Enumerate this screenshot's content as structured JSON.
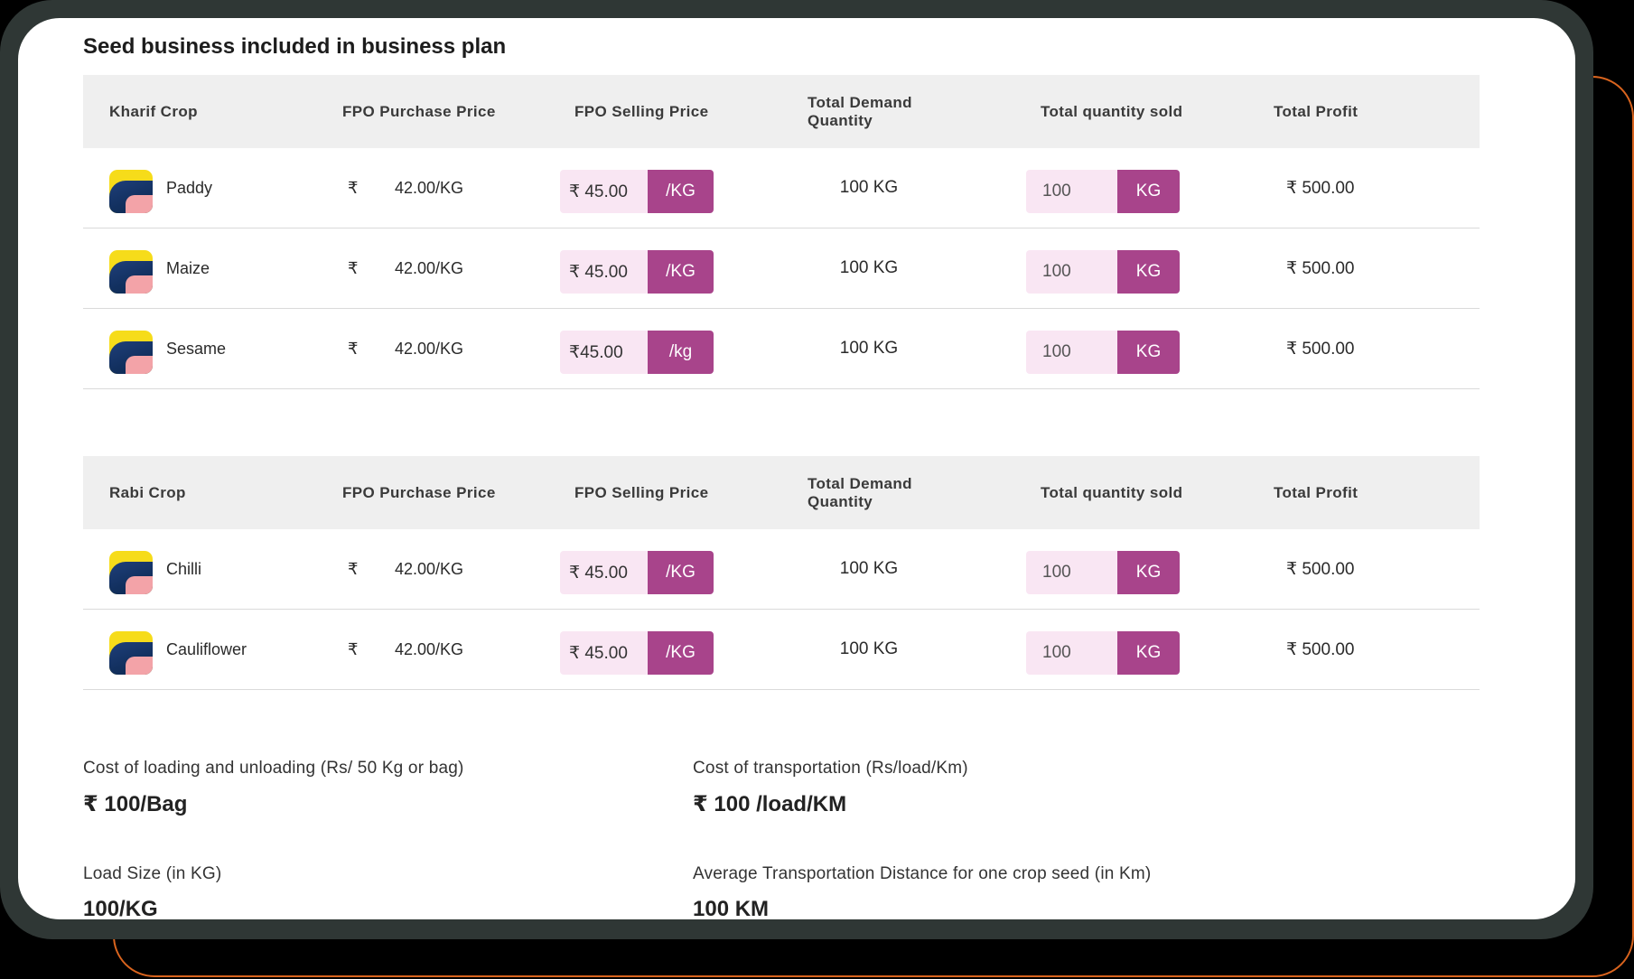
{
  "title": "Seed business included in business plan",
  "headers_common": {
    "purchase": "FPO Purchase Price",
    "selling": "FPO Selling Price",
    "demand": "Total Demand Quantity",
    "sold": "Total quantity sold",
    "profit": "Total Profit"
  },
  "kharif": {
    "header": "Kharif Crop",
    "rows": [
      {
        "name": "Paddy",
        "rupee": "₹",
        "purchase": "42.00/KG",
        "selling": "₹ 45.00",
        "selling_unit": "/KG",
        "demand": "100 KG",
        "sold": "100",
        "sold_unit": "KG",
        "profit": "₹  500.00"
      },
      {
        "name": "Maize",
        "rupee": "₹",
        "purchase": "42.00/KG",
        "selling": "₹ 45.00",
        "selling_unit": "/KG",
        "demand": "100 KG",
        "sold": "100",
        "sold_unit": "KG",
        "profit": "₹  500.00"
      },
      {
        "name": "Sesame",
        "rupee": "₹",
        "purchase": "42.00/KG",
        "selling": "₹45.00",
        "selling_unit": "/kg",
        "demand": "100 KG",
        "sold": "100",
        "sold_unit": "KG",
        "profit": "₹  500.00"
      }
    ]
  },
  "rabi": {
    "header": "Rabi Crop",
    "rows": [
      {
        "name": "Chilli",
        "rupee": "₹",
        "purchase": "42.00/KG",
        "selling": "₹ 45.00",
        "selling_unit": "/KG",
        "demand": "100 KG",
        "sold": "100",
        "sold_unit": "KG",
        "profit": "₹  500.00"
      },
      {
        "name": "Cauliflower",
        "rupee": "₹",
        "purchase": "42.00/KG",
        "selling": "₹ 45.00",
        "selling_unit": "/KG",
        "demand": "100 KG",
        "sold": "100",
        "sold_unit": "KG",
        "profit": "₹  500.00"
      }
    ]
  },
  "info": {
    "loading_label": "Cost of loading and unloading (Rs/ 50 Kg or bag)",
    "loading_value": "₹ 100/Bag",
    "transport_label": "Cost of transportation (Rs/load/Km)",
    "transport_value": "₹ 100 /load/KM",
    "load_size_label": "Load Size (in KG)",
    "load_size_value": "100/KG",
    "distance_label": "Average Transportation Distance for one crop seed (in Km)",
    "distance_value": "100 KM"
  },
  "colors": {
    "accent": "#a8448b",
    "accent_light": "#f9e6f3",
    "header_bg": "#efefef",
    "frame": "#2f3735",
    "outline": "#d9641e"
  },
  "icons": {
    "crop": "crop-thumbnail-icon"
  }
}
